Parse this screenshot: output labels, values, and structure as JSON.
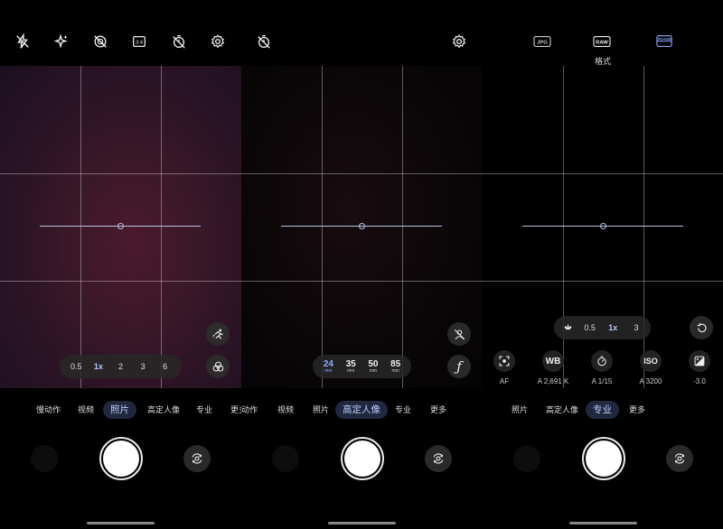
{
  "panels": [
    {
      "top_icons": [
        "flash-off-icon",
        "ai-sparkle-icon",
        "hdr-off-icon",
        "aspect-ratio-icon",
        "timer-off-icon",
        "settings-gear-icon"
      ],
      "aspect_label": "3:4",
      "zoom": [
        "0.5",
        "1x",
        "2",
        "3",
        "6"
      ],
      "zoom_selected": "1x",
      "side_buttons": [
        "motion-runner-icon",
        "color-filters-icon"
      ],
      "modes": [
        "慢动作",
        "视频",
        "照片",
        "高定人像",
        "专业",
        "更多"
      ],
      "mode_selected": "照片"
    },
    {
      "top_icons": [
        "timer-off-icon",
        "settings-gear-icon"
      ],
      "lenses": [
        {
          "value": "24",
          "unit": "mm"
        },
        {
          "value": "35",
          "unit": "mm"
        },
        {
          "value": "50",
          "unit": "mm"
        },
        {
          "value": "85",
          "unit": "mm"
        }
      ],
      "lens_selected": "24",
      "side_buttons": [
        "portrait-effect-off-icon",
        "aperture-f-icon"
      ],
      "aperture_glyph": "ƒ",
      "modes": [
        "动作",
        "视频",
        "照片",
        "高定人像",
        "专业",
        "更多"
      ],
      "mode_selected": "高定人像"
    },
    {
      "top_icons": [
        "jpg-format-icon",
        "raw-format-icon",
        "raw-plus-jpg-icon"
      ],
      "format_tags": [
        "JPG",
        "RAW",
        "JPG+RAW"
      ],
      "format_label": "格式",
      "zoom": [
        "macro",
        "0.5",
        "1x",
        "3"
      ],
      "zoom_selected": "1x",
      "reset_icon": "reset-icon",
      "pro_controls": [
        {
          "icon": "autofocus-icon",
          "value": "AF"
        },
        {
          "icon": "white-balance-icon",
          "glyph": "WB",
          "value": "A 2,691 K"
        },
        {
          "icon": "shutter-speed-icon",
          "value": "A 1/15"
        },
        {
          "icon": "iso-icon",
          "glyph": "ISO",
          "value": "A 3200"
        },
        {
          "icon": "exposure-icon",
          "value": "-3.0"
        }
      ],
      "modes": [
        "照片",
        "高定人像",
        "专业",
        "更多"
      ],
      "mode_selected": "专业"
    }
  ],
  "colors": {
    "accent": "#b9c8ff",
    "mode_pill_bg": "#20283f",
    "panel1_viewfinder": "#3a1828"
  }
}
